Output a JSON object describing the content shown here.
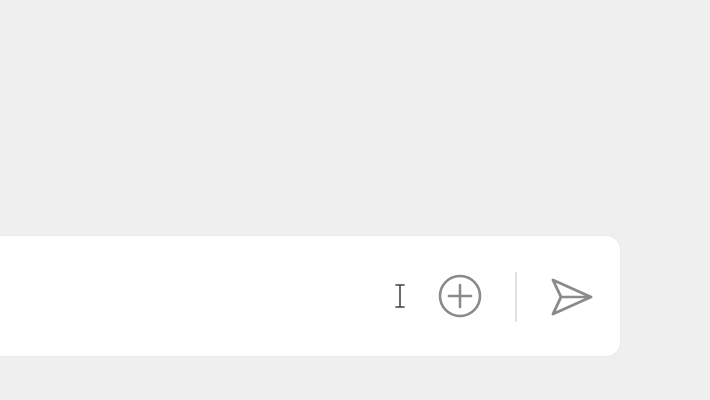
{
  "composer": {
    "input_value": "",
    "input_placeholder": "",
    "attach_icon": "plus-circle-icon",
    "send_icon": "send-icon",
    "icon_color": "#8a8a8a",
    "background_color": "#efefef",
    "panel_color": "#ffffff"
  }
}
